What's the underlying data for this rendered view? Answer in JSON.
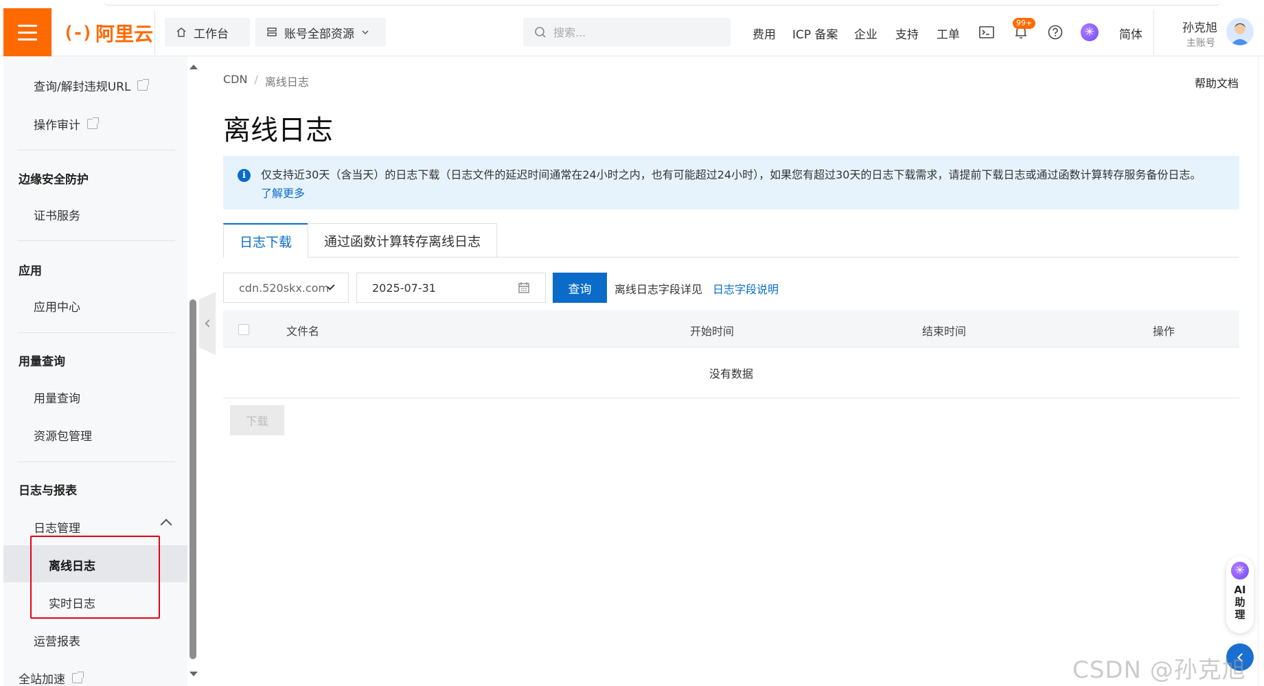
{
  "header": {
    "logo_text": "阿里云",
    "workbench": "工作台",
    "resources": "账号全部资源",
    "search_placeholder": "搜索...",
    "nav": [
      "费用",
      "ICP 备案",
      "企业",
      "支持",
      "工单"
    ],
    "notification_badge": "99+",
    "language": "简体",
    "user_name": "孙克旭",
    "user_role": "主账号"
  },
  "sidebar": {
    "items_top": [
      "查询/解封违规URL",
      "操作审计"
    ],
    "groups": {
      "edge_security": "边缘安全防护",
      "apps": "应用",
      "usage": "用量查询",
      "logs": "日志与报表"
    },
    "cert": "证书服务",
    "app_center": "应用中心",
    "usage_query": "用量查询",
    "package_mgmt": "资源包管理",
    "log_mgmt": "日志管理",
    "offline_log": "离线日志",
    "realtime_log": "实时日志",
    "ops_report": "运营报表",
    "dcdn": "全站加速"
  },
  "breadcrumb": {
    "root": "CDN",
    "sep": "/",
    "current": "离线日志"
  },
  "help_doc": "帮助文档",
  "page_title": "离线日志",
  "notice": {
    "text": "仅支持近30天（含当天）的日志下载（日志文件的延迟时间通常在24小时之内，也有可能超过24小时），如果您有超过30天的日志下载需求，请提前下载日志或通过函数计算转存服务备份日志。",
    "link": "了解更多"
  },
  "tabs": [
    "日志下载",
    "通过函数计算转存离线日志"
  ],
  "filters": {
    "domain": "cdn.520skx.com",
    "date": "2025-07-31",
    "query_button": "查询",
    "field_text": "离线日志字段详见",
    "field_link": "日志字段说明"
  },
  "table": {
    "columns": [
      "文件名",
      "开始时间",
      "结束时间",
      "操作"
    ],
    "empty": "没有数据"
  },
  "download_button": "下载",
  "ai_assistant": "AI助理",
  "watermark": "CSDN @孙克旭",
  "colors": {
    "brand": "#ff6a00",
    "primary": "#0a6cc8",
    "highlight": "#e60012"
  }
}
